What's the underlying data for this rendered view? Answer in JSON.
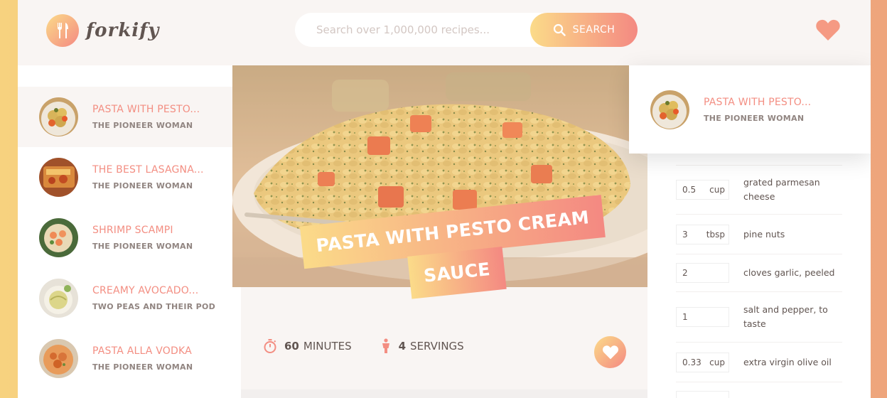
{
  "app": {
    "logo_text": "forkify"
  },
  "search": {
    "placeholder": "Search over 1,000,000 recipes...",
    "button_label": "SEARCH"
  },
  "results": [
    {
      "title": "PASTA WITH PESTO...",
      "publisher": "THE PIONEER WOMAN",
      "active": true
    },
    {
      "title": "THE BEST LASAGNA...",
      "publisher": "THE PIONEER WOMAN",
      "active": false
    },
    {
      "title": "SHRIMP SCAMPI",
      "publisher": "THE PIONEER WOMAN",
      "active": false
    },
    {
      "title": "CREAMY AVOCADO...",
      "publisher": "TWO PEAS AND THEIR POD",
      "active": false
    },
    {
      "title": "PASTA ALLA VODKA",
      "publisher": "THE PIONEER WOMAN",
      "active": false
    }
  ],
  "recipe": {
    "title_line1": "PASTA WITH PESTO CREAM",
    "title_line2": "SAUCE",
    "time_value": "60",
    "time_unit": "MINUTES",
    "servings_value": "4",
    "servings_unit": "SERVINGS"
  },
  "likes": [
    {
      "title": "PASTA WITH PESTO...",
      "publisher": "THE PIONEER WOMAN"
    }
  ],
  "ingredients": [
    {
      "count": "0.5",
      "unit": "cup",
      "text": "grated parmesan cheese"
    },
    {
      "count": "3",
      "unit": "tbsp",
      "text": "pine nuts"
    },
    {
      "count": "2",
      "unit": "",
      "text": "cloves garlic, peeled"
    },
    {
      "count": "1",
      "unit": "",
      "text": "salt and pepper, to taste"
    },
    {
      "count": "0.33",
      "unit": "cup",
      "text": "extra virgin olive oil"
    }
  ],
  "colors": {
    "accent": "#f38e82",
    "gradient_start": "#fbdb89",
    "gradient_end": "#f48982",
    "text": "#615551"
  }
}
